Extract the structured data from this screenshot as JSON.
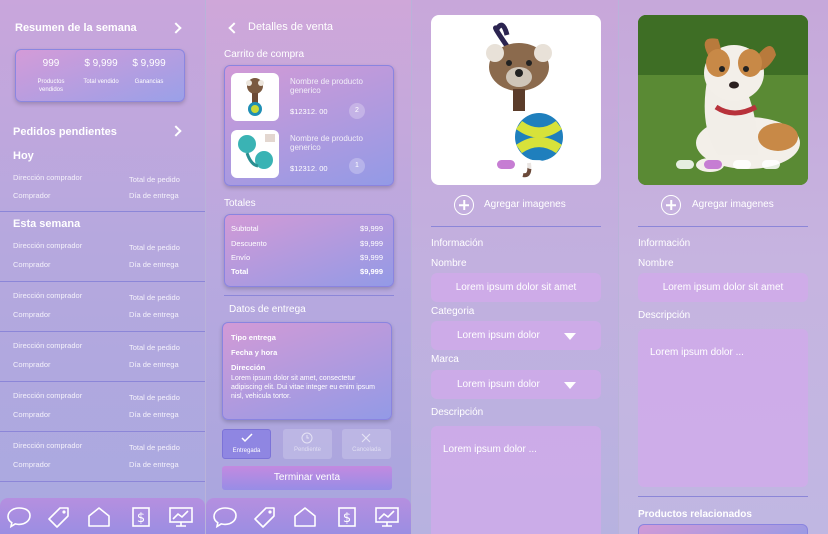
{
  "screen1": {
    "summary_title": "Resumen de la semana",
    "summary": [
      {
        "value": "999",
        "label": "Productos vendidos"
      },
      {
        "value": "$ 9,999",
        "label": "Total vendido"
      },
      {
        "value": "$ 9,999",
        "label": "Ganancias"
      }
    ],
    "pending_title": "Pedidos pendientes",
    "today_title": "Hoy",
    "week_title": "Esta semana",
    "row": {
      "address": "Dirección comprador",
      "buyer": "Comprador",
      "total": "Total de pedido",
      "date": "Día de entrega"
    }
  },
  "screen2": {
    "title": "Detalles de venta",
    "cart_title": "Carrito de compra",
    "products": [
      {
        "name": "Nombre de producto generico",
        "price": "$12312. 00",
        "qty": "2"
      },
      {
        "name": "Nombre de producto generico",
        "price": "$12312. 00",
        "qty": "1"
      }
    ],
    "totals_title": "Totales",
    "totals": [
      {
        "label": "Subtotal",
        "value": "$9,999"
      },
      {
        "label": "Descuento",
        "value": "$9,999"
      },
      {
        "label": "Envío",
        "value": "$9,999"
      },
      {
        "label": "Total",
        "value": "$9,999"
      }
    ],
    "delivery_title": "Datos de entrega",
    "delivery": {
      "type": "Tipo entrega",
      "date": "Fecha y hora",
      "address_label": "Dirección",
      "address_text": "Lorem ipsum dolor sit amet, consectetur adipiscing elit. Dui vitae integer eu enim ipsum nisl, vehicula tortor."
    },
    "status_buttons": [
      "Entregada",
      "Pendiente",
      "Cancelada"
    ],
    "finish_label": "Terminar venta"
  },
  "screen3": {
    "add_images": "Agregar imagenes",
    "info_title": "Información",
    "name_label": "Nombre",
    "name_value": "Lorem ipsum dolor sit amet",
    "category_label": "Categoria",
    "category_value": "Lorem ipsum dolor",
    "brand_label": "Marca",
    "brand_value": "Lorem ipsum dolor",
    "desc_label": "Descripción",
    "desc_value": "Lorem ipsum dolor ..."
  },
  "screen4": {
    "add_images": "Agregar imagenes",
    "info_title": "Información",
    "name_label": "Nombre",
    "name_value": "Lorem ipsum dolor sit amet",
    "desc_label": "Descripción",
    "desc_value": "Lorem ipsum dolor ...",
    "related_title": "Productos relacionados"
  },
  "colors": {
    "accent": "#c67dd3",
    "divider": "#8c86d8"
  },
  "icons": [
    "chat-icon",
    "tag-icon",
    "home-icon",
    "dollar-icon",
    "chart-icon"
  ]
}
